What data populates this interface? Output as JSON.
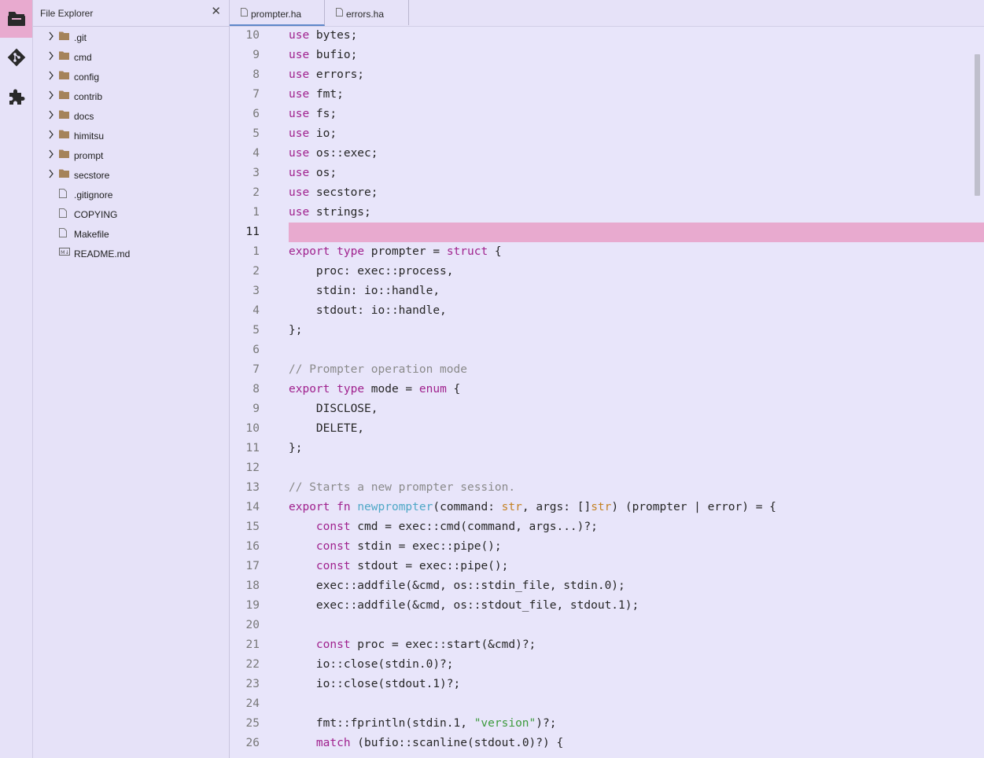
{
  "activity_bar": {
    "items": [
      {
        "name": "file-explorer-icon",
        "active": true
      },
      {
        "name": "git-icon",
        "active": false
      },
      {
        "name": "extensions-icon",
        "active": false
      }
    ]
  },
  "sidebar": {
    "title": "File Explorer",
    "close_glyph": "✕",
    "items": [
      {
        "label": ".git",
        "kind": "folder"
      },
      {
        "label": "cmd",
        "kind": "folder"
      },
      {
        "label": "config",
        "kind": "folder"
      },
      {
        "label": "contrib",
        "kind": "folder"
      },
      {
        "label": "docs",
        "kind": "folder"
      },
      {
        "label": "himitsu",
        "kind": "folder"
      },
      {
        "label": "prompt",
        "kind": "folder"
      },
      {
        "label": "secstore",
        "kind": "folder"
      },
      {
        "label": ".gitignore",
        "kind": "file"
      },
      {
        "label": "COPYING",
        "kind": "file"
      },
      {
        "label": "Makefile",
        "kind": "file"
      },
      {
        "label": "README.md",
        "kind": "markdown"
      }
    ]
  },
  "tabs": [
    {
      "label": "prompter.ha",
      "active": true
    },
    {
      "label": "errors.ha",
      "active": false
    }
  ],
  "editor": {
    "lines": [
      {
        "num": "10",
        "tokens": [
          {
            "t": "use",
            "c": "kw"
          },
          {
            "t": " bytes;"
          }
        ]
      },
      {
        "num": "9",
        "tokens": [
          {
            "t": "use",
            "c": "kw"
          },
          {
            "t": " bufio;"
          }
        ]
      },
      {
        "num": "8",
        "tokens": [
          {
            "t": "use",
            "c": "kw"
          },
          {
            "t": " errors;"
          }
        ]
      },
      {
        "num": "7",
        "tokens": [
          {
            "t": "use",
            "c": "kw"
          },
          {
            "t": " fmt;"
          }
        ]
      },
      {
        "num": "6",
        "tokens": [
          {
            "t": "use",
            "c": "kw"
          },
          {
            "t": " fs;"
          }
        ]
      },
      {
        "num": "5",
        "tokens": [
          {
            "t": "use",
            "c": "kw"
          },
          {
            "t": " io;"
          }
        ]
      },
      {
        "num": "4",
        "tokens": [
          {
            "t": "use",
            "c": "kw"
          },
          {
            "t": " os::exec;"
          }
        ]
      },
      {
        "num": "3",
        "tokens": [
          {
            "t": "use",
            "c": "kw"
          },
          {
            "t": " os;"
          }
        ]
      },
      {
        "num": "2",
        "tokens": [
          {
            "t": "use",
            "c": "kw"
          },
          {
            "t": " secstore;"
          }
        ]
      },
      {
        "num": "1",
        "tokens": [
          {
            "t": "use",
            "c": "kw"
          },
          {
            "t": " strings;"
          }
        ]
      },
      {
        "num": "11",
        "current": true,
        "tokens": []
      },
      {
        "num": "1",
        "tokens": [
          {
            "t": "export",
            "c": "kw"
          },
          {
            "t": " "
          },
          {
            "t": "type",
            "c": "kw"
          },
          {
            "t": " prompter = "
          },
          {
            "t": "struct",
            "c": "kw"
          },
          {
            "t": " {"
          }
        ]
      },
      {
        "num": "2",
        "tokens": [
          {
            "t": "    proc: exec::process,"
          }
        ]
      },
      {
        "num": "3",
        "tokens": [
          {
            "t": "    stdin: io::handle,"
          }
        ]
      },
      {
        "num": "4",
        "tokens": [
          {
            "t": "    stdout: io::handle,"
          }
        ]
      },
      {
        "num": "5",
        "tokens": [
          {
            "t": "};"
          }
        ]
      },
      {
        "num": "6",
        "tokens": []
      },
      {
        "num": "7",
        "tokens": [
          {
            "t": "// Prompter operation mode",
            "c": "cm"
          }
        ]
      },
      {
        "num": "8",
        "tokens": [
          {
            "t": "export",
            "c": "kw"
          },
          {
            "t": " "
          },
          {
            "t": "type",
            "c": "kw"
          },
          {
            "t": " mode = "
          },
          {
            "t": "enum",
            "c": "kw"
          },
          {
            "t": " {"
          }
        ]
      },
      {
        "num": "9",
        "tokens": [
          {
            "t": "    DISCLOSE,"
          }
        ]
      },
      {
        "num": "10",
        "tokens": [
          {
            "t": "    DELETE,"
          }
        ]
      },
      {
        "num": "11",
        "tokens": [
          {
            "t": "};"
          }
        ]
      },
      {
        "num": "12",
        "tokens": []
      },
      {
        "num": "13",
        "tokens": [
          {
            "t": "// Starts a new prompter session.",
            "c": "cm"
          }
        ]
      },
      {
        "num": "14",
        "tokens": [
          {
            "t": "export",
            "c": "kw"
          },
          {
            "t": " "
          },
          {
            "t": "fn",
            "c": "kw"
          },
          {
            "t": " "
          },
          {
            "t": "newprompter",
            "c": "fn"
          },
          {
            "t": "(command: "
          },
          {
            "t": "str",
            "c": "ty"
          },
          {
            "t": ", args: []"
          },
          {
            "t": "str",
            "c": "ty"
          },
          {
            "t": ") (prompter | error) = {"
          }
        ]
      },
      {
        "num": "15",
        "tokens": [
          {
            "t": "    "
          },
          {
            "t": "const",
            "c": "kw"
          },
          {
            "t": " cmd = exec::cmd(command, args...)?;"
          }
        ]
      },
      {
        "num": "16",
        "tokens": [
          {
            "t": "    "
          },
          {
            "t": "const",
            "c": "kw"
          },
          {
            "t": " stdin = exec::pipe();"
          }
        ]
      },
      {
        "num": "17",
        "tokens": [
          {
            "t": "    "
          },
          {
            "t": "const",
            "c": "kw"
          },
          {
            "t": " stdout = exec::pipe();"
          }
        ]
      },
      {
        "num": "18",
        "tokens": [
          {
            "t": "    exec::addfile(&cmd, os::stdin_file, stdin.0);"
          }
        ]
      },
      {
        "num": "19",
        "tokens": [
          {
            "t": "    exec::addfile(&cmd, os::stdout_file, stdout.1);"
          }
        ]
      },
      {
        "num": "20",
        "tokens": []
      },
      {
        "num": "21",
        "tokens": [
          {
            "t": "    "
          },
          {
            "t": "const",
            "c": "kw"
          },
          {
            "t": " proc = exec::start(&cmd)?;"
          }
        ]
      },
      {
        "num": "22",
        "tokens": [
          {
            "t": "    io::close(stdin.0)?;"
          }
        ]
      },
      {
        "num": "23",
        "tokens": [
          {
            "t": "    io::close(stdout.1)?;"
          }
        ]
      },
      {
        "num": "24",
        "tokens": []
      },
      {
        "num": "25",
        "tokens": [
          {
            "t": "    fmt::fprintln(stdin.1, "
          },
          {
            "t": "\"version\"",
            "c": "str"
          },
          {
            "t": ")?;"
          }
        ]
      },
      {
        "num": "26",
        "tokens": [
          {
            "t": "    "
          },
          {
            "t": "match",
            "c": "kw"
          },
          {
            "t": " (bufio::scanline(stdout.0)?) {"
          }
        ]
      }
    ]
  },
  "colors": {
    "background": "#e8e5fa",
    "current_line_highlight": "#e8aacf",
    "keyword": "#a0228e",
    "function": "#4fa8c7",
    "type": "#c48223",
    "string": "#3c9a3c",
    "comment": "#8a8a8a",
    "folder": "#a5835a",
    "active_tab_underline": "#5e87c9"
  }
}
